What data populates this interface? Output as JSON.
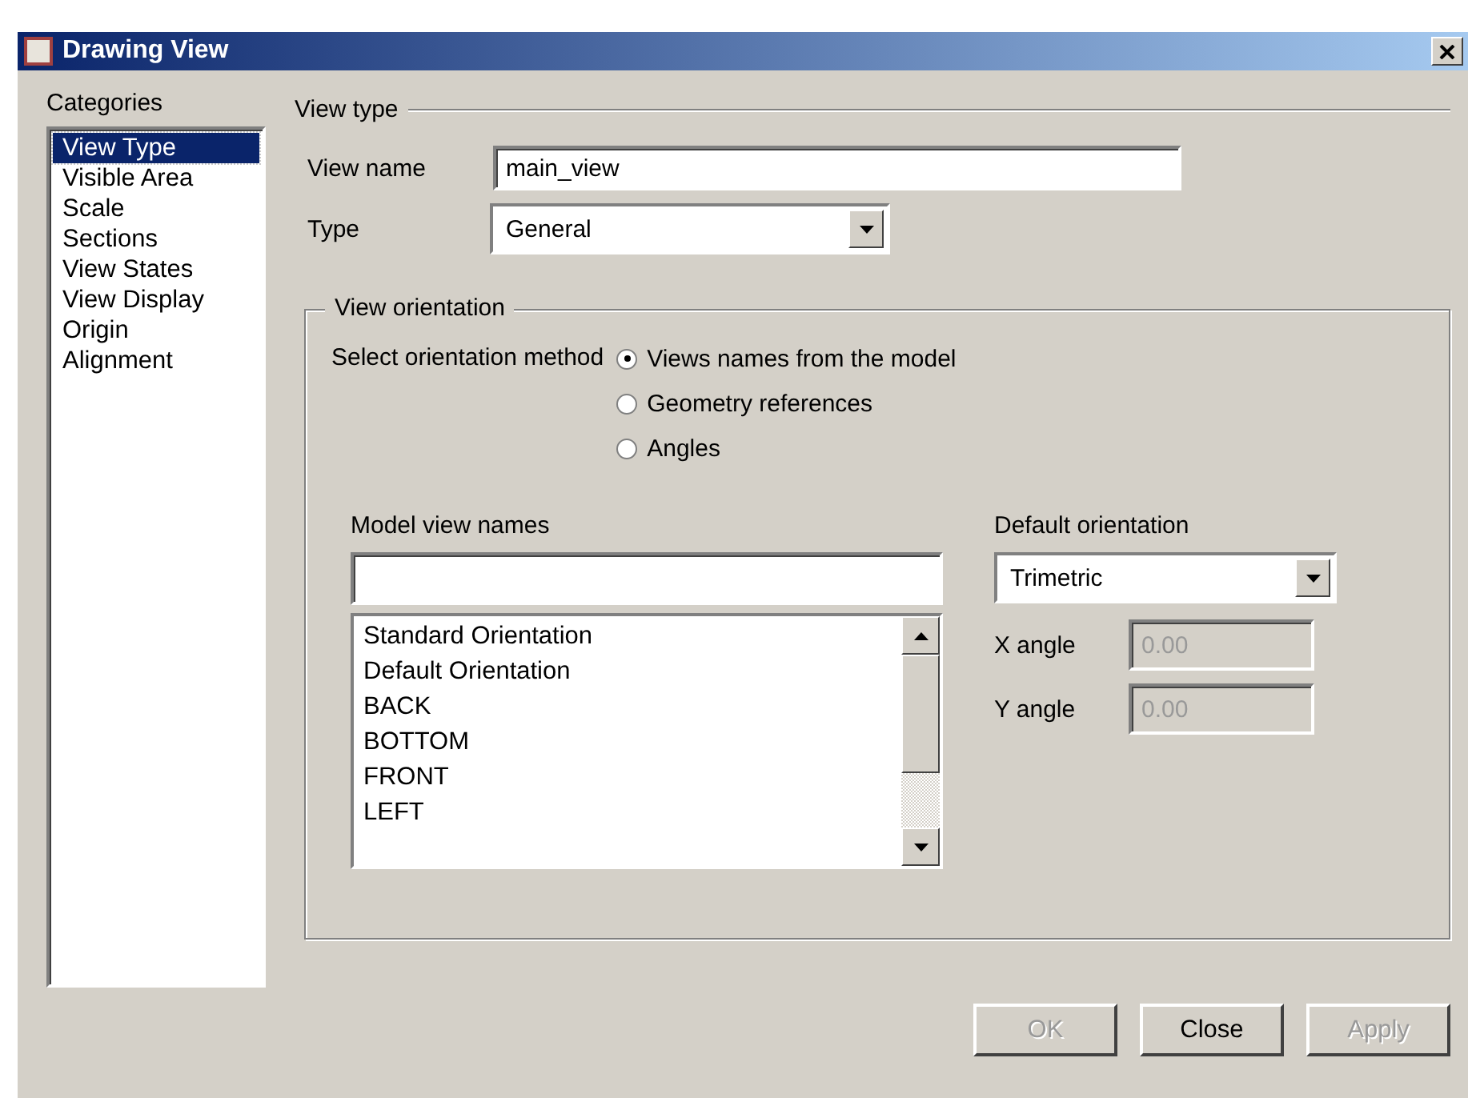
{
  "window": {
    "title": "Drawing View"
  },
  "categories": {
    "label": "Categories",
    "items": [
      {
        "label": "View Type",
        "selected": true
      },
      {
        "label": "Visible Area",
        "selected": false
      },
      {
        "label": "Scale",
        "selected": false
      },
      {
        "label": "Sections",
        "selected": false
      },
      {
        "label": "View States",
        "selected": false
      },
      {
        "label": "View Display",
        "selected": false
      },
      {
        "label": "Origin",
        "selected": false
      },
      {
        "label": "Alignment",
        "selected": false
      }
    ]
  },
  "view_type": {
    "legend": "View type",
    "view_name": {
      "label": "View name",
      "value": "main_view"
    },
    "type": {
      "label": "Type",
      "value": "General"
    }
  },
  "orientation": {
    "legend": "View orientation",
    "method_label": "Select orientation method",
    "methods": [
      {
        "label": "Views names from the model",
        "selected": true
      },
      {
        "label": "Geometry references",
        "selected": false
      },
      {
        "label": "Angles",
        "selected": false
      }
    ],
    "model_view_names": {
      "label": "Model view names",
      "items": [
        "Standard Orientation",
        "Default Orientation",
        "BACK",
        "BOTTOM",
        "FRONT",
        "LEFT"
      ]
    },
    "default_orientation": {
      "label": "Default orientation",
      "value": "Trimetric"
    },
    "angles": [
      {
        "label": "X angle",
        "value": "0.00",
        "disabled": true
      },
      {
        "label": "Y angle",
        "value": "0.00",
        "disabled": true
      }
    ]
  },
  "buttons": [
    {
      "label": "OK",
      "disabled": true
    },
    {
      "label": "Close",
      "disabled": false
    },
    {
      "label": "Apply",
      "disabled": true
    }
  ]
}
